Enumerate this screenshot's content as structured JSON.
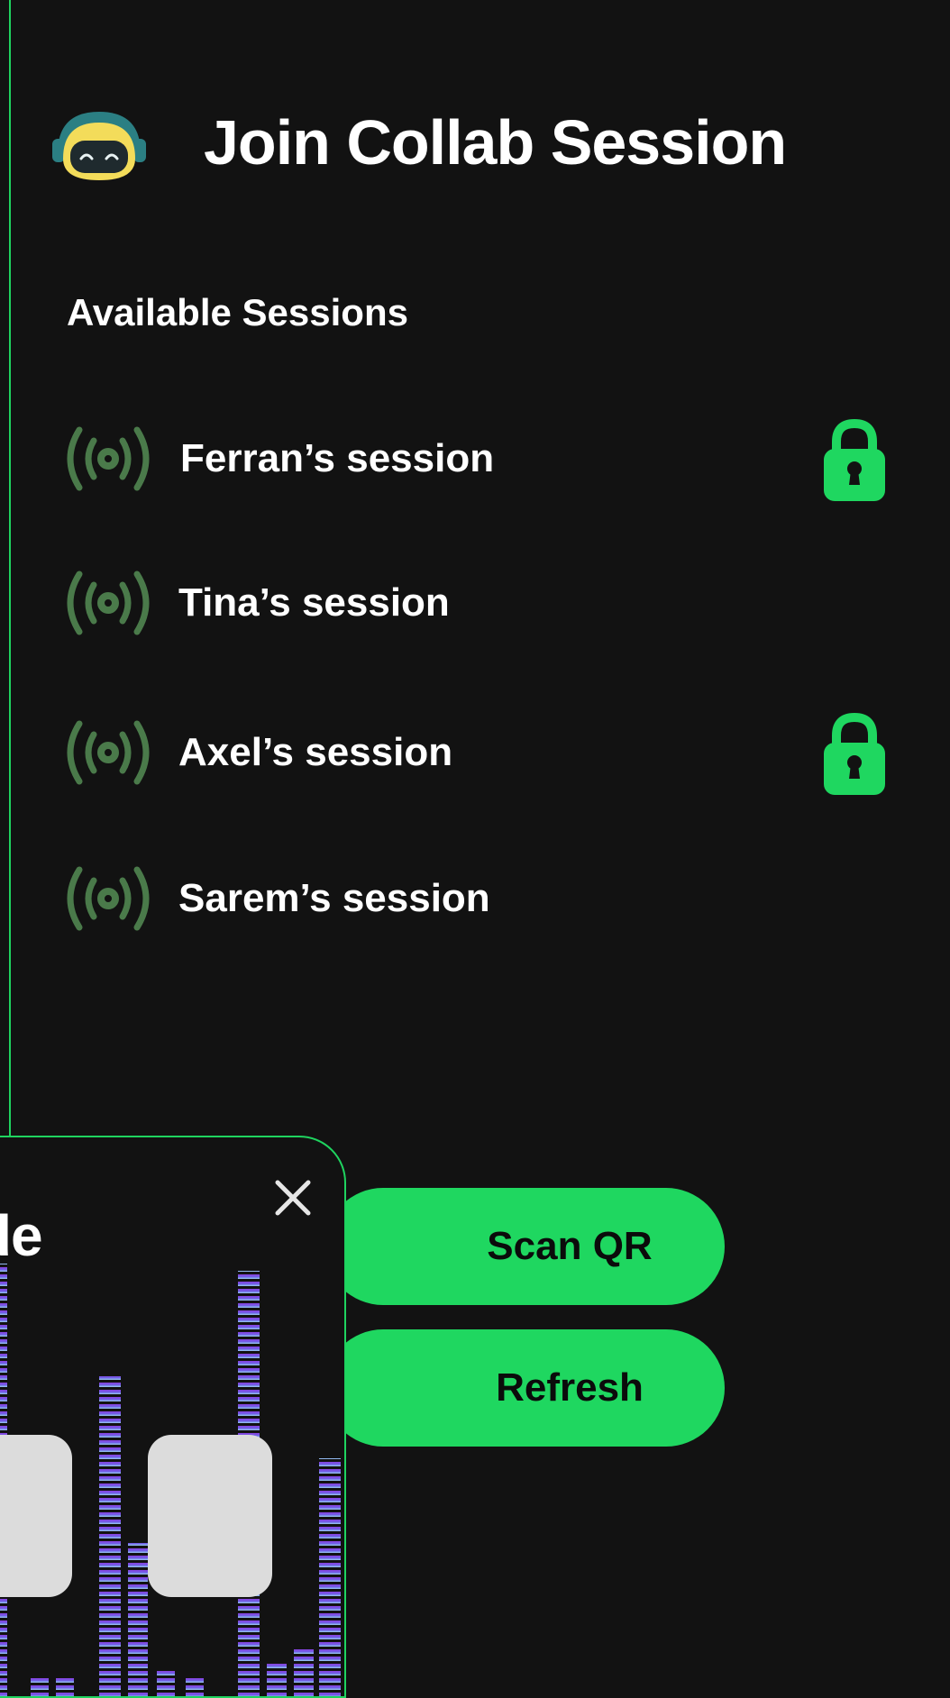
{
  "header": {
    "title": "Join Collab Session",
    "avatar_icon": "robot-avatar-icon"
  },
  "sessions_section": {
    "label": "Available Sessions",
    "items": [
      {
        "name": "Ferran’s session",
        "locked": true
      },
      {
        "name": "Tina’s session",
        "locked": false
      },
      {
        "name": "Axel’s session",
        "locked": true
      },
      {
        "name": "Sarem’s session",
        "locked": false
      }
    ]
  },
  "actions": {
    "scan_label": "Scan QR",
    "refresh_label": "Refresh"
  },
  "passcode_modal": {
    "title_visible": "sscode",
    "close_icon": "close-icon",
    "pin_fields_visible": 2
  },
  "colors": {
    "background": "#121212",
    "accent": "#1fd760",
    "signal": "#4a7a4a",
    "pin_box": "#dcdcdc"
  }
}
